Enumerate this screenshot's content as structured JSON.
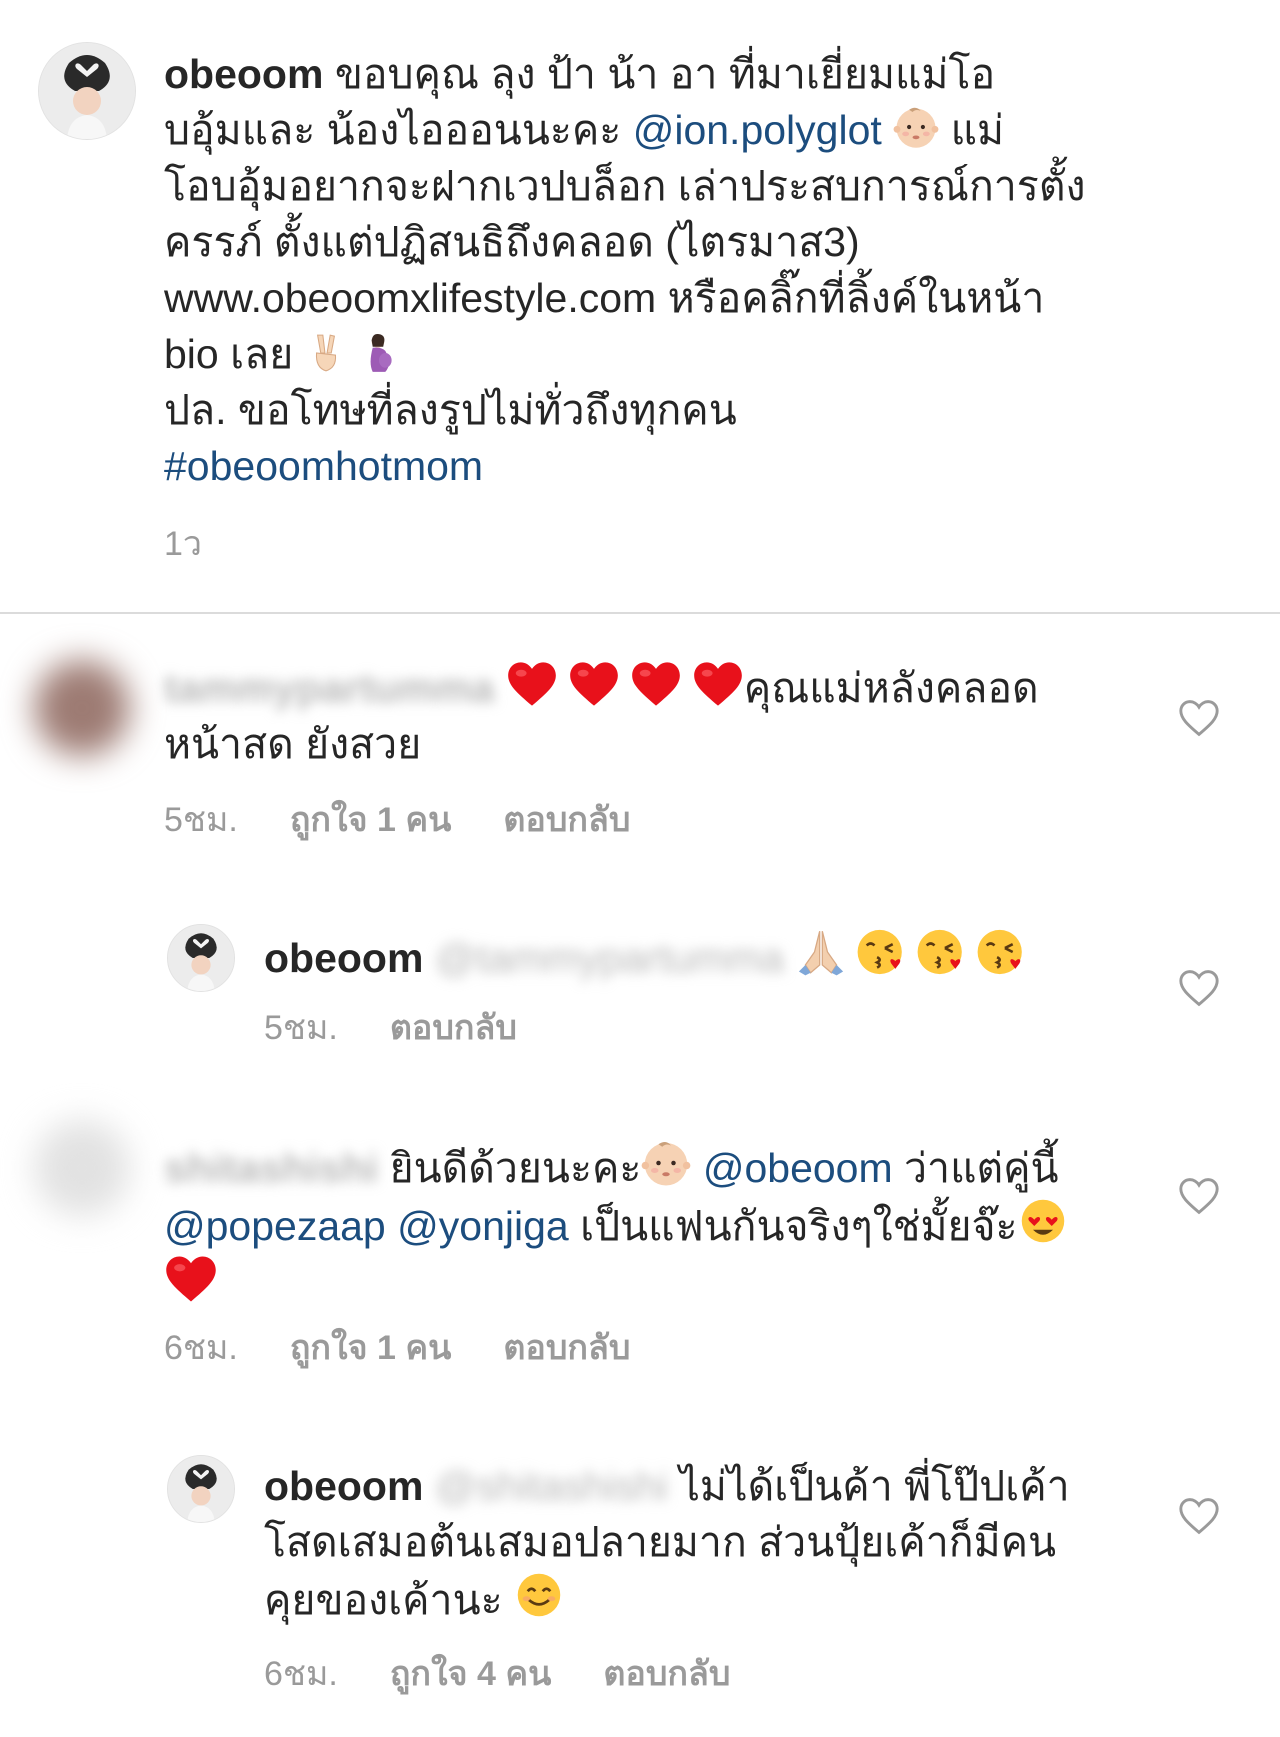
{
  "caption": {
    "username": "obeoom",
    "text_1": "ขอบคุณ ลุง ป้า น้า อา ที่มาเยี่ยมแม่โอ",
    "text_2": "บอุ้มและ น้องไอออนนะคะ ",
    "mention": "@ion.polyglot",
    "text_3": " แม่",
    "text_4": "โอบอุ้มอยากจะฝากเวปบล็อก เล่าประสบการณ์การตั้ง",
    "text_5": "ครรภ์ ตั้งแต่ปฏิสนธิถึงคลอด (ไตรมาส3)",
    "text_6": "www.obeoomxlifestyle.com หรือคลิ๊กที่ลิ้งค์ในหน้า",
    "text_7": "bio เลย",
    "text_8": "ปล. ขอโทษที่ลงรูปไม่ทั่วถึงทุกคน",
    "hashtag": "#obeoomhotmom",
    "time": "1ว"
  },
  "comments": [
    {
      "username": "tammypartumma",
      "line_1": "คุณแม่หลังคลอด",
      "line_2": "หน้าสด ยังสวย",
      "time": "5ชม.",
      "likes": "ถูกใจ 1 คน",
      "reply": "ตอบกลับ"
    },
    {
      "username": "obeoom",
      "mention": "@tammypartumma",
      "time": "5ชม.",
      "reply": "ตอบกลับ"
    },
    {
      "username": "shitashishi",
      "text_1": "ยินดีด้วยนะคะ",
      "mention_1": "@obeoom",
      "text_2": " ว่าแต่คู่นี้",
      "mention_2": "@popezaap",
      "mention_3": "@yonjiga",
      "text_3": " เป็นแฟนกันจริงๆใช่มั้ยจ๊ะ",
      "time": "6ชม.",
      "likes": "ถูกใจ 1 คน",
      "reply": "ตอบกลับ"
    },
    {
      "username": "obeoom",
      "mention": "@shitashishi",
      "line_1": "ไม่ได้เป็นค้า พี่โป๊ปเค้า",
      "line_2": "โสดเสมอต้นเสมอปลายมาก ส่วนปุ้ยเค้าก็มีคน",
      "line_3": "คุยของเค้านะ",
      "time": "6ชม.",
      "likes": "ถูกใจ 4 คน",
      "reply": "ตอบกลับ"
    }
  ],
  "icons": {
    "like": "heart-outline-icon",
    "baby": "baby-face-emoji",
    "victory": "victory-hand-emoji",
    "pregnant": "pregnant-woman-emoji",
    "heart": "red-heart-emoji",
    "pray": "folded-hands-emoji",
    "kiss": "face-blowing-kiss-emoji",
    "heart_eyes": "heart-eyes-emoji",
    "smile": "smiling-face-emoji"
  },
  "colors": {
    "text": "#262626",
    "link": "#1c4d7e",
    "meta": "#9a9a9a",
    "divider": "#dbdbdb",
    "heart": "#e8111b"
  }
}
